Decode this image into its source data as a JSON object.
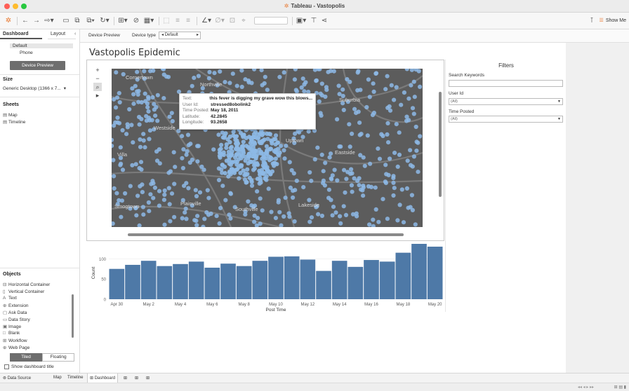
{
  "window": {
    "title": "Tableau - Vastopolis"
  },
  "toolbar": {
    "show_me_label": "Show Me"
  },
  "left_pane": {
    "tabs": [
      "Dashboard",
      "Layout"
    ],
    "device_options": [
      "Default",
      "Phone"
    ],
    "device_preview_button": "Device Preview",
    "size_heading": "Size",
    "size_value": "Generic Desktop (1366 x 7...",
    "sheets_heading": "Sheets",
    "sheets": [
      "Map",
      "Timeline"
    ],
    "objects_heading": "Objects",
    "objects": [
      "Horizontal Container",
      "Vertical Container",
      "Text",
      "Extension",
      "Ask Data",
      "Data Story",
      "Image",
      "Blank",
      "Workflow",
      "Web Page"
    ],
    "tiled_label": "Tiled",
    "floating_label": "Floating",
    "show_title_label": "Show dashboard title"
  },
  "dash_tabs": {
    "device_preview": "Device Preview",
    "device_type_label": "Device type",
    "device_type_value": "Default"
  },
  "dashboard": {
    "title": "Vastopolis Epidemic",
    "map": {
      "places": [
        "Cornertown",
        "Northville",
        "Suburbia",
        "Westside",
        "Villa",
        "Uptown",
        "Eastside",
        "Smogtown",
        "Plainville",
        "Southville",
        "Lakeside"
      ],
      "controls": [
        "+",
        "−",
        "⌕",
        "▸"
      ]
    },
    "tooltip": {
      "rows": [
        {
          "key": "Text:",
          "value": "this fever is digging my grave wow this blows..."
        },
        {
          "key": "User Id:",
          "value": "stressed8obolink2"
        },
        {
          "key": "Time Posted:",
          "value": "May 18, 2011"
        },
        {
          "key": "Latitude:",
          "value": "42.2845"
        },
        {
          "key": "Longitude:",
          "value": "93.2658"
        }
      ]
    },
    "filters": {
      "title": "Filters",
      "search_label": "Search Keywords",
      "user_label": "User Id",
      "user_value": "(All)",
      "time_label": "Time Posted",
      "time_value": "(All)"
    }
  },
  "chart_data": {
    "type": "bar",
    "xlabel": "Post Time",
    "ylabel": "Count",
    "ylim": [
      0,
      130
    ],
    "yticks": [
      0,
      50,
      100
    ],
    "categories": [
      "Apr 30",
      "May 1",
      "May 2",
      "May 3",
      "May 4",
      "May 5",
      "May 6",
      "May 7",
      "May 8",
      "May 9",
      "May 10",
      "May 11",
      "May 12",
      "May 13",
      "May 14",
      "May 15",
      "May 16",
      "May 17",
      "May 18",
      "May 19",
      "May 20"
    ],
    "tick_labels": [
      "Apr 30",
      "May 2",
      "May 4",
      "May 6",
      "May 8",
      "May 10",
      "May 12",
      "May 14",
      "May 16",
      "May 18",
      "May 20"
    ],
    "values": [
      75,
      85,
      95,
      82,
      87,
      93,
      78,
      88,
      82,
      95,
      105,
      106,
      98,
      70,
      95,
      80,
      97,
      93,
      115,
      137,
      130
    ],
    "color": "#4e79a7"
  },
  "bottom_tabs": [
    "Data Source",
    "Map",
    "Timeline",
    "Dashboard"
  ],
  "colors": {
    "accent": "#e8762c",
    "bar": "#4e79a7",
    "dot": "#8db9e6"
  }
}
